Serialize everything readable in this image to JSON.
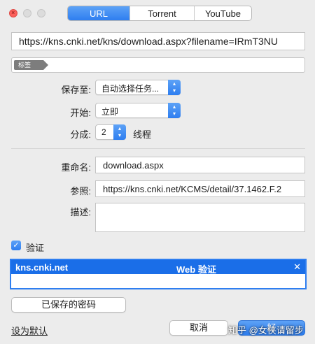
{
  "tabs": [
    "URL",
    "Torrent",
    "YouTube"
  ],
  "url_value": "https://kns.cnki.net/kns/download.aspx?filename=IRmT3NU",
  "tag_chip": "标签",
  "save_to": {
    "label": "保存至:",
    "value": "自动选择任务..."
  },
  "start": {
    "label": "开始:",
    "value": "立即"
  },
  "split": {
    "label": "分成:",
    "value": "2",
    "unit": "线程"
  },
  "rename": {
    "label": "重命名:",
    "value": "download.aspx"
  },
  "referer": {
    "label": "参照:",
    "value": "https://kns.cnki.net/KCMS/detail/37.1462.F.2"
  },
  "description": {
    "label": "描述:",
    "value": ""
  },
  "auth": {
    "label": "验证",
    "checked": true,
    "host": "kns.cnki.net",
    "type": "Web 验证",
    "close": "✕"
  },
  "buttons": {
    "saved_passwords": "已保存的密码",
    "set_default": "设为默认",
    "cancel": "取消",
    "ok": "好"
  },
  "watermark": "知乎 @女侠请留步",
  "colors": {
    "accent": "#2e7ef0",
    "selection": "#1a6ee8",
    "close_light": "#fc605b"
  }
}
